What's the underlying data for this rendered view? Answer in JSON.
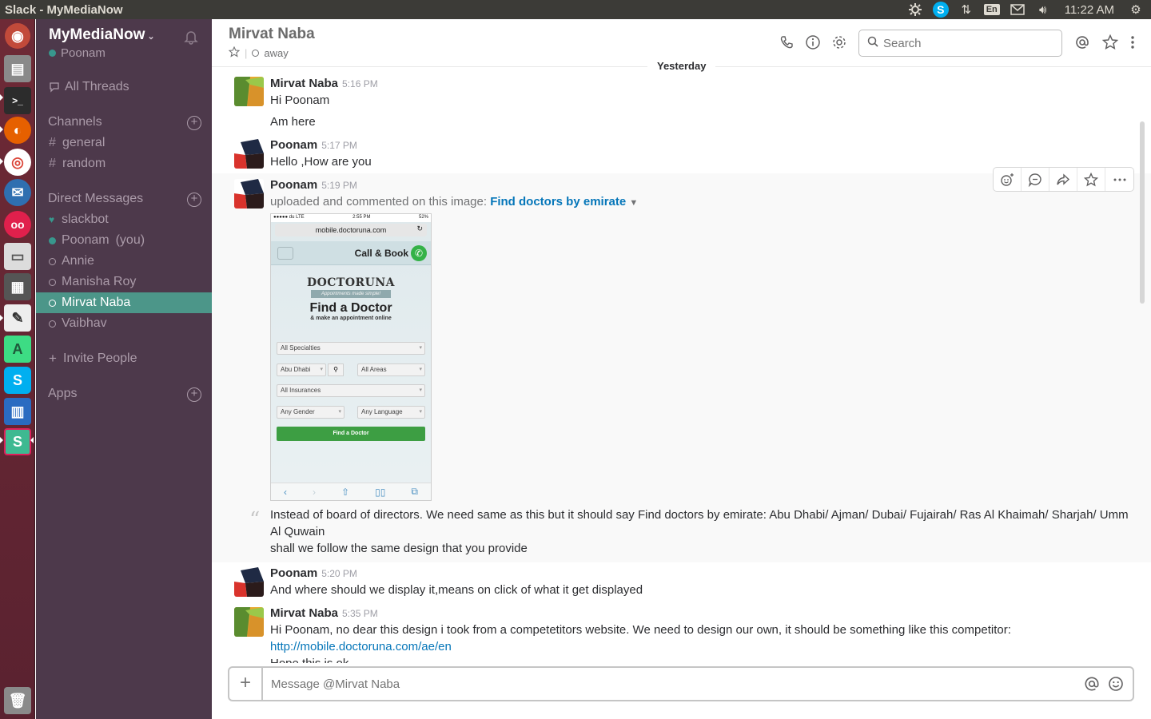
{
  "window": {
    "title": "Slack - MyMediaNow"
  },
  "tray": {
    "keyboard": "En",
    "clock": "11:22 AM"
  },
  "launcher": {
    "items": [
      "ubuntu-dash",
      "files",
      "terminal",
      "firefox",
      "chrome",
      "thunderbird",
      "flickr",
      "document-scanner",
      "calculator",
      "text-editor",
      "android-studio",
      "skype",
      "libreoffice-writer",
      "slack",
      "trash"
    ]
  },
  "sidebar": {
    "workspace": "MyMediaNow",
    "user": "Poonam",
    "all_threads": "All Threads",
    "channels_header": "Channels",
    "channels": [
      "general",
      "random"
    ],
    "dm_header": "Direct Messages",
    "dms": [
      {
        "name": "slackbot",
        "status": "bot"
      },
      {
        "name": "Poonam",
        "suffix": "(you)",
        "status": "online"
      },
      {
        "name": "Annie",
        "status": "away"
      },
      {
        "name": "Manisha Roy",
        "status": "away"
      },
      {
        "name": "Mirvat Naba",
        "status": "away",
        "active": true
      },
      {
        "name": "Vaibhav",
        "status": "away"
      }
    ],
    "invite": "Invite People",
    "apps_header": "Apps"
  },
  "header": {
    "title": "Mirvat Naba",
    "status": "away",
    "search_placeholder": "Search"
  },
  "messages": {
    "day_divider": "Yesterday",
    "m1": {
      "sender": "Mirvat Naba",
      "time": "5:16 PM",
      "lines": [
        "Hi Poonam",
        "Am here"
      ]
    },
    "m2": {
      "sender": "Poonam",
      "time": "5:17 PM",
      "text": "Hello ,How are you"
    },
    "m3": {
      "sender": "Poonam",
      "time": "5:19 PM",
      "upload_prefix": "uploaded and commented on this image:",
      "file_name": "Find doctors by emirate",
      "comment_line1": "Instead of board of directors. We need same as this but it should say Find doctors by emirate: Abu Dhabi/ Ajman/ Dubai/ Fujairah/ Ras Al Khaimah/ Sharjah/ Umm",
      "comment_line2": "Al Quwain",
      "comment_line3": "shall we follow the same design that you provide"
    },
    "m4": {
      "sender": "Poonam",
      "time": "5:20 PM",
      "text": "And where should we display it,means on click of what it get displayed"
    },
    "m5": {
      "sender": "Mirvat Naba",
      "time": "5:35 PM",
      "text": "Hi Poonam, no dear this design i took from a competetitors website. We need to design our own, it should be something like this competitor:",
      "link": "http://mobile.doctoruna.com/ae/en",
      "cut_line": "Hope this is ok"
    }
  },
  "screenshot": {
    "status_left": "●●●●● du  LTE",
    "status_time": "2:55 PM",
    "status_right": "52%",
    "url": "mobile.doctoruna.com",
    "call_book": "Call & Book",
    "logo": "DOCTORUNA",
    "tagline": "Appointments made simple!",
    "find_title": "Find a Doctor",
    "find_sub": "& make an appointment online",
    "sel_specialties": "All Specialties",
    "sel_city": "Abu Dhabi",
    "sel_areas": "All Areas",
    "sel_insurances": "All Insurances",
    "sel_gender": "Any Gender",
    "sel_language": "Any Language",
    "find_button": "Find a Doctor"
  },
  "composer": {
    "placeholder": "Message @Mirvat Naba"
  },
  "colors": {
    "sidebar_bg": "#4d394b",
    "active_item": "#4c9689",
    "link": "#0576b9",
    "launcher_bg": "#6e2a36"
  }
}
